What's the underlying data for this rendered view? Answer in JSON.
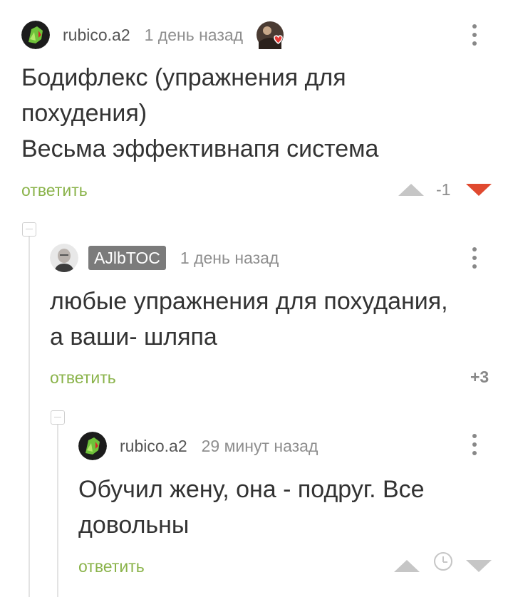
{
  "comments": [
    {
      "author": "rubico.a2",
      "time": "1 день назад",
      "lines": [
        "Бодифлекс (упражнения для",
        "похудения)",
        "Весьма эффективнапя система"
      ],
      "reply_label": "ответить",
      "rating": "-1"
    },
    {
      "author": "AJlbTOC",
      "time": "1 день назад",
      "lines": [
        "любые упражнения для похудания,",
        "а ваши- шляпа"
      ],
      "reply_label": "ответить",
      "rating": "+3"
    },
    {
      "author": "rubico.a2",
      "time": "29 минут назад",
      "lines": [
        "Обучил жену, она - подруг. Все",
        "довольны"
      ],
      "reply_label": "ответить"
    }
  ],
  "icons": {
    "badge_icon": "heart-avatar-icon",
    "more": "kebab-icon",
    "upvote": "triangle-up-icon",
    "downvote": "triangle-down-icon",
    "pending": "clock-icon",
    "collapse": "minus-box-icon"
  },
  "colors": {
    "reply": "#8ab34a",
    "downvote_active": "#e0492f",
    "vote_idle": "#c6c6c6",
    "author_badge": "#7b7b7b"
  }
}
